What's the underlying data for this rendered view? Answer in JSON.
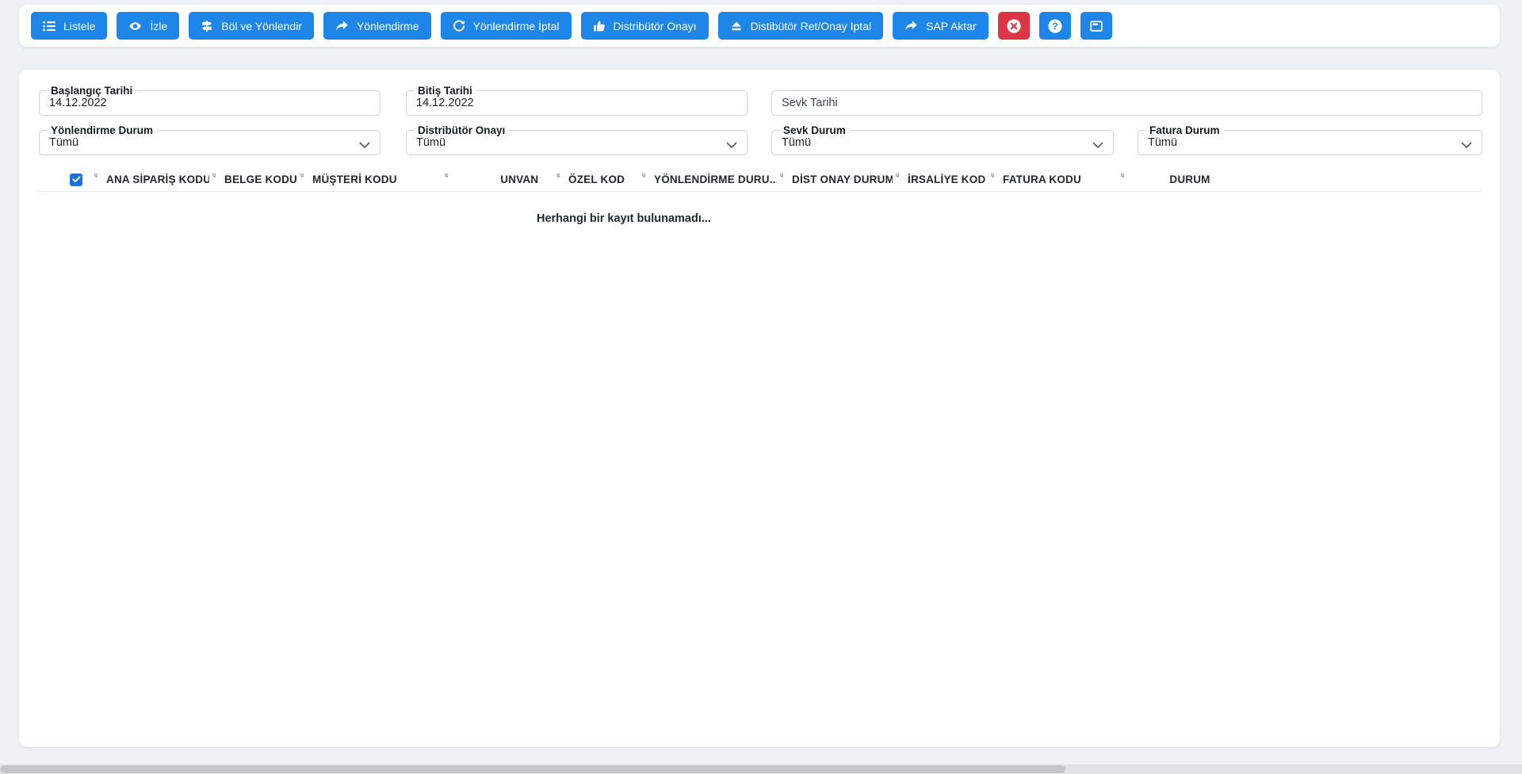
{
  "colors": {
    "primary": "#1d86e8",
    "danger": "#dc3545"
  },
  "toolbar": {
    "buttons": [
      {
        "label": "Listele",
        "icon": "list-icon"
      },
      {
        "label": "İzle",
        "icon": "eye-icon"
      },
      {
        "label": "Böl ve Yönlendir",
        "icon": "signpost-icon"
      },
      {
        "label": "Yönlendirme",
        "icon": "share-arrow-icon"
      },
      {
        "label": "Yönlendirme İptal",
        "icon": "refresh-icon"
      },
      {
        "label": "Distribütör Onayı",
        "icon": "thumbs-up-icon"
      },
      {
        "label": "Distibütör Ret/Onay Iptal",
        "icon": "eject-icon"
      },
      {
        "label": "SAP Aktar",
        "icon": "share-arrow-icon"
      }
    ],
    "icon_buttons": [
      {
        "icon": "x-circle-icon",
        "color": "#dc3545"
      },
      {
        "icon": "question-circle-icon",
        "color": "#1d86e8"
      },
      {
        "icon": "window-icon",
        "color": "#1d86e8"
      }
    ]
  },
  "filters": {
    "row1": [
      {
        "label": "Başlangıç Tarihi",
        "value": "14.12.2022"
      },
      {
        "label": "Bitiş Tarihi",
        "value": "14.12.2022"
      },
      {
        "placeholder": "Sevk Tarihi",
        "value": ""
      }
    ],
    "row2": [
      {
        "label": "Yönlendirme Durum",
        "value": "Tümü"
      },
      {
        "label": "Distribütör Onayı",
        "value": "Tümü"
      },
      {
        "label": "Sevk Durum",
        "value": "Tümü"
      },
      {
        "label": "Fatura Durum",
        "value": "Tümü"
      }
    ]
  },
  "table": {
    "select_all_checked": true,
    "columns": [
      "ANA SİPARİŞ KODU",
      "BELGE KODU",
      "MÜŞTERİ KODU",
      "UNVAN",
      "ÖZEL KOD",
      "YÖNLENDİRME DURU...",
      "DİST ONAY DURUM",
      "İRSALİYE KOD",
      "FATURA KODU",
      "DURUM"
    ],
    "empty_message": "Herhangi bir kayıt bulunamadı..."
  }
}
